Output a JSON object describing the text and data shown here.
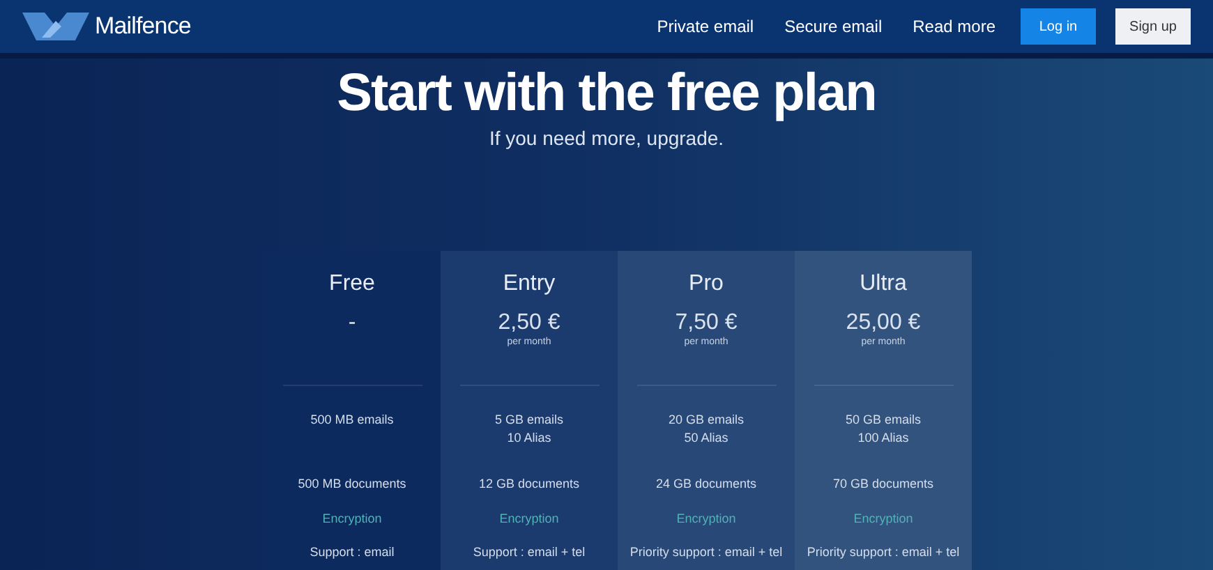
{
  "header": {
    "brand": "Mailfence",
    "nav": [
      "Private email",
      "Secure email",
      "Read more"
    ],
    "login": "Log in",
    "signup": "Sign up"
  },
  "hero": {
    "title": "Start with the free plan",
    "subtitle": "If you need more, upgrade."
  },
  "plans": [
    {
      "name": "Free",
      "price": "-",
      "color": "#0c2a5e",
      "emails": [
        "500 MB emails"
      ],
      "documents": "500 MB documents",
      "encryption": "Encryption",
      "support": "Support : email"
    },
    {
      "name": "Entry",
      "price": "2,50 €",
      "period": "per month",
      "color": "#1b3a6d",
      "emails": [
        "5 GB emails",
        "10 Alias"
      ],
      "documents": "12 GB documents",
      "encryption": "Encryption",
      "support": "Support : email + tel"
    },
    {
      "name": "Pro",
      "price": "7,50 €",
      "period": "per month",
      "color": "#284878",
      "emails": [
        "20 GB emails",
        "50 Alias"
      ],
      "documents": "24 GB documents",
      "encryption": "Encryption",
      "support": "Priority support : email + tel"
    },
    {
      "name": "Ultra",
      "price": "25,00 €",
      "period": "per month",
      "color": "#33537f",
      "emails": [
        "50 GB emails",
        "100 Alias"
      ],
      "documents": "70 GB documents",
      "encryption": "Encryption",
      "support": "Priority support : email + tel"
    }
  ]
}
